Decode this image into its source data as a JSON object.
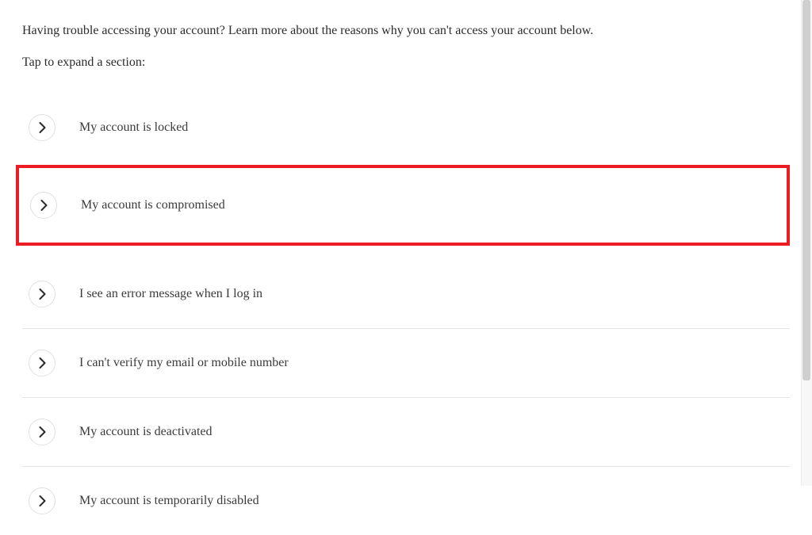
{
  "intro_text": "Having trouble accessing your account? Learn more about the reasons why you can't access your account below.",
  "tap_hint": "Tap to expand a section:",
  "items": [
    {
      "label": "My account is locked"
    },
    {
      "label": "My account is compromised"
    },
    {
      "label": "I see an error message when I log in"
    },
    {
      "label": "I can't verify my email or mobile number"
    },
    {
      "label": "My account is deactivated"
    },
    {
      "label": "My account is temporarily disabled"
    }
  ],
  "highlight_index": 1
}
